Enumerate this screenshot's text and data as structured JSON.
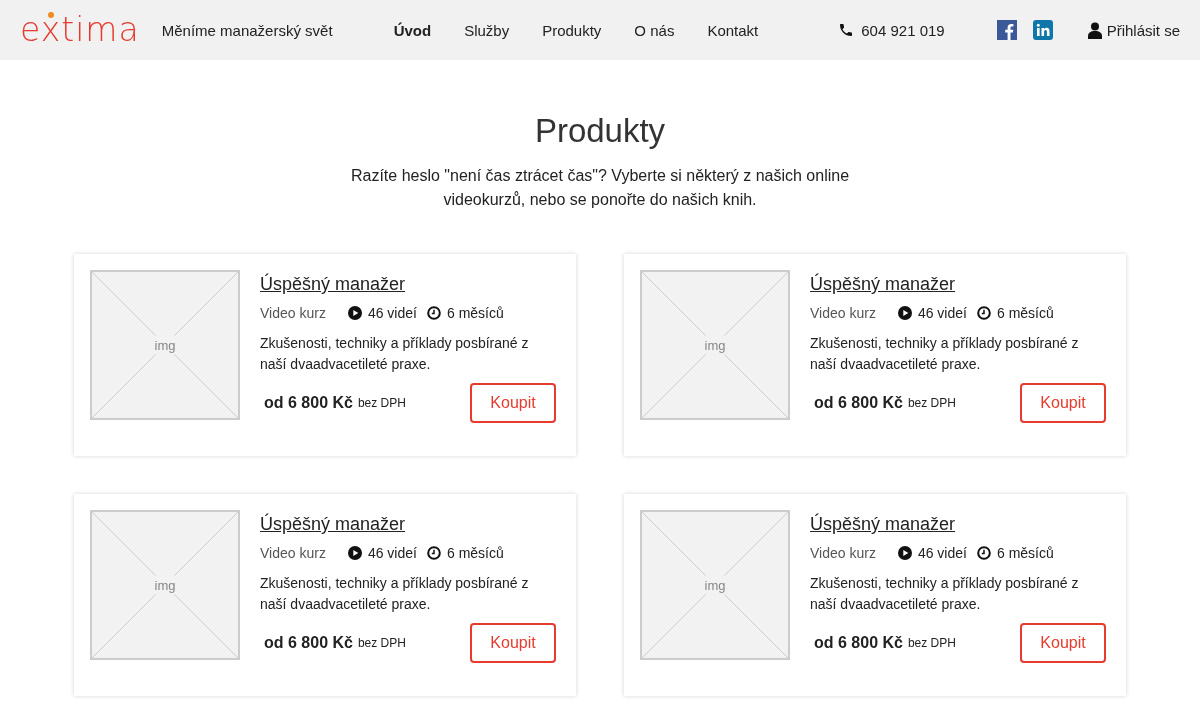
{
  "header": {
    "logo": "extima",
    "tagline": "Měníme manažerský svět",
    "nav": [
      {
        "label": "Úvod",
        "selected": true
      },
      {
        "label": "Služby",
        "selected": false
      },
      {
        "label": "Produkty",
        "selected": false
      },
      {
        "label": "O nás",
        "selected": false
      },
      {
        "label": "Kontakt",
        "selected": false
      }
    ],
    "phone": "604 921 019",
    "login": "Přihlásit se"
  },
  "title": "Produkty",
  "intro": "Razíte heslo \"není čas ztrácet čas\"? Vyberte si některý z našich online videokurzů, nebo se ponořte do našich knih.",
  "products": [
    {
      "image_label": "img",
      "name": "Úspěšný manažer",
      "type": "Video kurz",
      "videos": "46 videí",
      "duration": "6 měsíců",
      "description": "Zkušenosti, techniky a příklady posbírané z naší dvaadvacetileté praxe.",
      "price": "od 6 800 Kč",
      "price_note": "bez DPH",
      "button": "Koupit"
    },
    {
      "image_label": "img",
      "name": "Úspěšný manažer",
      "type": "Video kurz",
      "videos": "46 videí",
      "duration": "6 měsíců",
      "description": "Zkušenosti, techniky a příklady posbírané z naší dvaadvacetileté praxe.",
      "price": "od 6 800 Kč",
      "price_note": "bez DPH",
      "button": "Koupit"
    },
    {
      "image_label": "img",
      "name": "Úspěšný manažer",
      "type": "Video kurz",
      "videos": "46 videí",
      "duration": "6 měsíců",
      "description": "Zkušenosti, techniky a příklady posbírané z naší dvaadvacetileté praxe.",
      "price": "od 6 800 Kč",
      "price_note": "bez DPH",
      "button": "Koupit"
    },
    {
      "image_label": "img",
      "name": "Úspěšný manažer",
      "type": "Video kurz",
      "videos": "46 videí",
      "duration": "6 měsíců",
      "description": "Zkušenosti, techniky a příklady posbírané z naší dvaadvacetileté praxe.",
      "price": "od 6 800 Kč",
      "price_note": "bez DPH",
      "button": "Koupit"
    }
  ]
}
